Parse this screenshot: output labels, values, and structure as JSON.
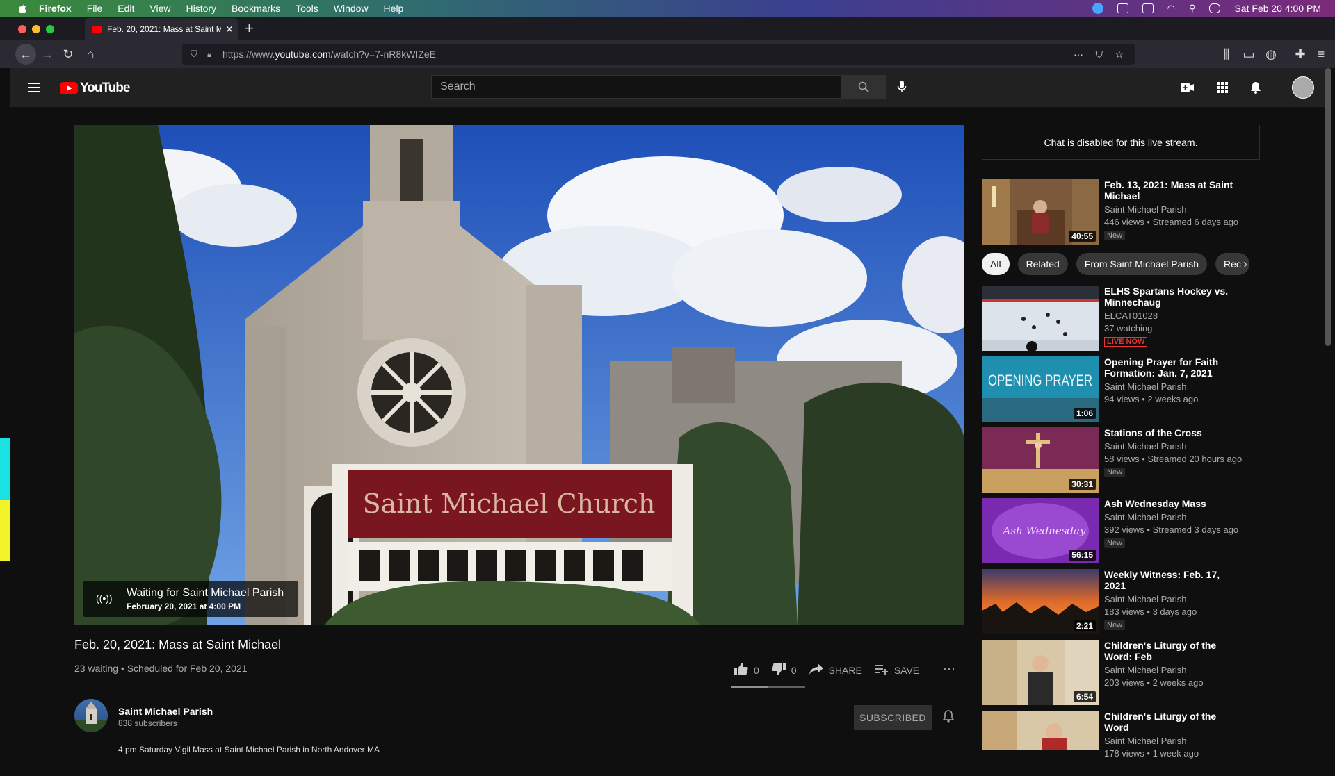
{
  "menubar": {
    "app": "Firefox",
    "items": [
      "File",
      "Edit",
      "View",
      "History",
      "Bookmarks",
      "Tools",
      "Window",
      "Help"
    ],
    "clock": "Sat Feb 20  4:00 PM"
  },
  "browser": {
    "tab_title": "Feb. 20, 2021: Mass at Saint M",
    "url_prefix": "https://www.",
    "url_domain": "youtube.com",
    "url_path": "/watch?v=7-nR8kWIZeE"
  },
  "youtube": {
    "logo": "YouTube",
    "search_placeholder": "Search"
  },
  "player": {
    "waiting_title": "Waiting for Saint Michael Parish",
    "waiting_time": "February 20, 2021 at 4:00 PM",
    "sign_text": "Saint Michael Church"
  },
  "video": {
    "title": "Feb. 20, 2021: Mass at Saint Michael",
    "meta": "23 waiting • Scheduled for Feb 20, 2021",
    "likes": "0",
    "dislikes": "0",
    "like_ratio": 0.5,
    "share": "SHARE",
    "save": "SAVE",
    "channel": "Saint Michael Parish",
    "subscribers": "838 subscribers",
    "subscribed_label": "SUBSCRIBED",
    "description": "4 pm Saturday Vigil Mass at Saint Michael Parish in North Andover MA"
  },
  "sidebar": {
    "chat_text": "Chat is disabled for this live stream.",
    "top_rec": {
      "title": "Feb. 13, 2021: Mass at Saint Michael",
      "channel": "Saint Michael Parish",
      "meta": "446 views • Streamed 6 days ago",
      "badge": "New",
      "duration": "40:55"
    },
    "chips": [
      "All",
      "Related",
      "From Saint Michael Parish",
      "Rec"
    ],
    "recs": [
      {
        "title": "ELHS Spartans Hockey vs. Minnechaug",
        "channel": "ELCAT01028",
        "meta": "37 watching",
        "badge": "LIVE NOW",
        "duration": ""
      },
      {
        "title": "Opening Prayer for Faith Formation: Jan. 7, 2021",
        "channel": "Saint Michael Parish",
        "meta": "94 views • 2 weeks ago",
        "badge": "",
        "duration": "1:06"
      },
      {
        "title": "Stations of the Cross",
        "channel": "Saint Michael Parish",
        "meta": "58 views • Streamed 20 hours ago",
        "badge": "New",
        "duration": "30:31"
      },
      {
        "title": "Ash Wednesday Mass",
        "channel": "Saint Michael Parish",
        "meta": "392 views • Streamed 3 days ago",
        "badge": "New",
        "duration": "56:15"
      },
      {
        "title": "Weekly Witness: Feb. 17, 2021",
        "channel": "Saint Michael Parish",
        "meta": "183 views • 3 days ago",
        "badge": "New",
        "duration": "2:21"
      },
      {
        "title": "Children's Liturgy of the Word: Feb",
        "channel": "Saint Michael Parish",
        "meta": "203 views • 2 weeks ago",
        "badge": "",
        "duration": "6:54"
      },
      {
        "title": "Children's Liturgy of the Word",
        "channel": "Saint Michael Parish",
        "meta": "178 views • 1 week ago",
        "badge": "",
        "duration": ""
      }
    ],
    "thumb_text_opening": "OPENING PRAYER",
    "thumb_text_ash": "Ash Wednesday"
  }
}
